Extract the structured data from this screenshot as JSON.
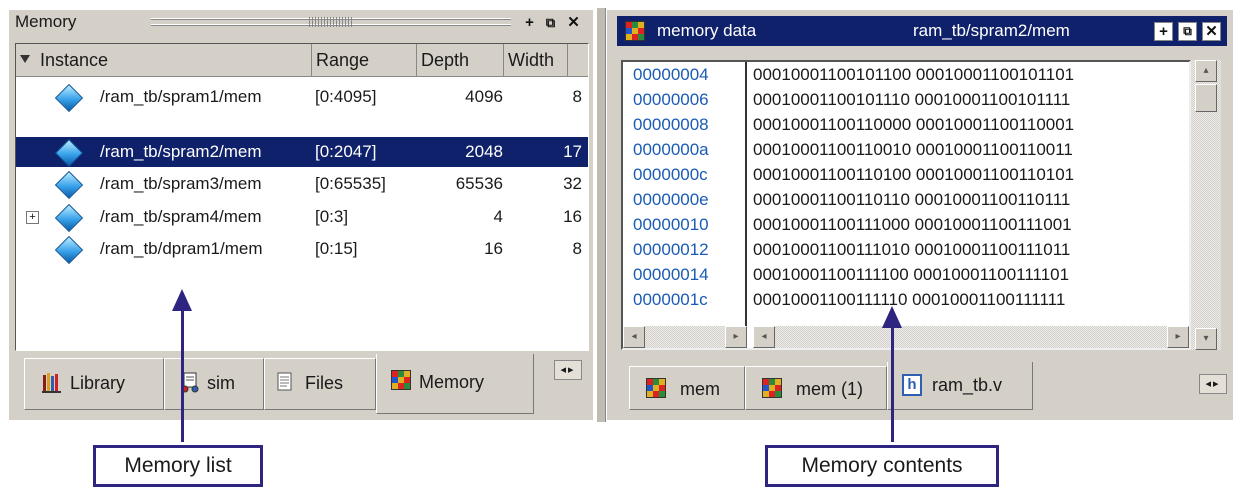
{
  "memory_panel": {
    "title": "Memory",
    "columns": [
      "Instance",
      "Range",
      "Depth",
      "Width"
    ],
    "rows": [
      {
        "instance": "/ram_tb/spram1/mem",
        "range": "[0:4095]",
        "depth": "4096",
        "width": "8",
        "selected": false,
        "expandable": false
      },
      {
        "instance": "/ram_tb/spram2/mem",
        "range": "[0:2047]",
        "depth": "2048",
        "width": "17",
        "selected": true,
        "expandable": false
      },
      {
        "instance": "/ram_tb/spram3/mem",
        "range": "[0:65535]",
        "depth": "65536",
        "width": "32",
        "selected": false,
        "expandable": false
      },
      {
        "instance": "/ram_tb/spram4/mem",
        "range": "[0:3]",
        "depth": "4",
        "width": "16",
        "selected": false,
        "expandable": true
      },
      {
        "instance": "/ram_tb/dpram1/mem",
        "range": "[0:15]",
        "depth": "16",
        "width": "8",
        "selected": false,
        "expandable": false
      }
    ],
    "tabs": [
      {
        "label": "Library",
        "icon": "library-icon"
      },
      {
        "label": "sim",
        "icon": "sim-icon"
      },
      {
        "label": "Files",
        "icon": "files-icon"
      },
      {
        "label": "Memory",
        "icon": "memory-icon",
        "active": true
      }
    ]
  },
  "memory_data_panel": {
    "title": "memory data",
    "path": "ram_tb/spram2/mem",
    "lines": [
      {
        "addr": "00000004",
        "data": "00010001100101100 00010001100101101"
      },
      {
        "addr": "00000006",
        "data": "00010001100101110 00010001100101111"
      },
      {
        "addr": "00000008",
        "data": "00010001100110000 00010001100110001"
      },
      {
        "addr": "0000000a",
        "data": "00010001100110010 00010001100110011"
      },
      {
        "addr": "0000000c",
        "data": "00010001100110100 00010001100110101"
      },
      {
        "addr": "0000000e",
        "data": "00010001100110110 00010001100110111"
      },
      {
        "addr": "00000010",
        "data": "00010001100111000 00010001100111001"
      },
      {
        "addr": "00000012",
        "data": "00010001100111010 00010001100111011"
      },
      {
        "addr": "00000014",
        "data": "00010001100111100 00010001100111101"
      },
      {
        "addr": "0000001c",
        "data": "00010001100111110 00010001100111111"
      }
    ],
    "tabs": [
      {
        "label": "mem",
        "icon": "memory-icon"
      },
      {
        "label": "mem (1)",
        "icon": "memory-icon"
      },
      {
        "label": "ram_tb.v",
        "icon": "hdl-file-icon",
        "active": true
      }
    ]
  },
  "window_buttons": {
    "dock": "+",
    "undock": "⧉",
    "close": "✕"
  },
  "callouts": {
    "left": "Memory list",
    "right": "Memory contents"
  },
  "colors": {
    "selection": "#10216b",
    "callout": "#2d2580",
    "address": "#1a5bb5"
  }
}
